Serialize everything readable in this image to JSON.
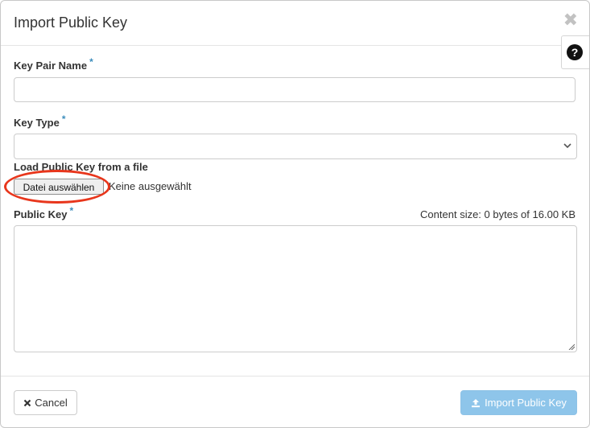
{
  "dialog": {
    "title": "Import Public Key",
    "close_glyph": "✖",
    "help_glyph": "?"
  },
  "form": {
    "key_pair_name": {
      "label": "Key Pair Name",
      "required_mark": "*",
      "value": ""
    },
    "key_type": {
      "label": "Key Type",
      "required_mark": "*",
      "selected": ""
    },
    "load_file": {
      "label": "Load Public Key from a file",
      "button_label": "Datei auswählen",
      "status": "Keine ausgewählt"
    },
    "public_key": {
      "label": "Public Key",
      "required_mark": "*",
      "content_size": "Content size: 0 bytes of 16.00 KB",
      "value": ""
    }
  },
  "footer": {
    "cancel_label": "Cancel",
    "import_label": "Import Public Key"
  },
  "icons": {
    "close": "close-icon",
    "help": "question-circle-icon",
    "select": "chevron-down-icon",
    "cancel": "times-icon",
    "import": "upload-icon"
  },
  "colors": {
    "required_mark": "#3c8dbc",
    "primary_disabled": "#8ec5ea",
    "annotation": "#e8361c"
  }
}
